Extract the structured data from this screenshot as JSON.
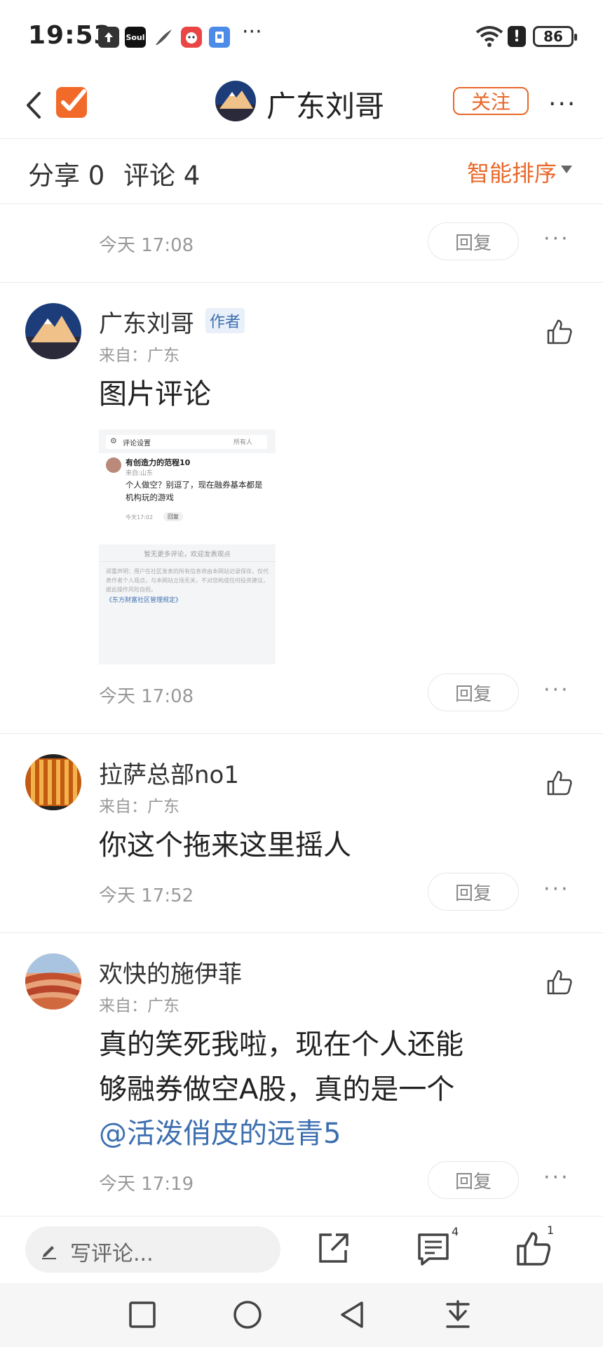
{
  "status_bar": {
    "time": "19:53",
    "app_icons": [
      "upload-icon",
      "soul-app-icon",
      "feather-app-icon",
      "mascot-app-icon",
      "badge-app-icon"
    ],
    "soul_text": "Soul",
    "overflow": "···",
    "battery": "86"
  },
  "header": {
    "title": "广东刘哥",
    "follow_label": "关注",
    "more": "···"
  },
  "tabs": {
    "share": "分享 0",
    "comments": "评论 4",
    "sort_label": "智能排序"
  },
  "comments": [
    {
      "time": "今天 17:08",
      "reply_label": "回复"
    },
    {
      "user": "广东刘哥",
      "author_tag": "作者",
      "from": "来自：广东",
      "text": "图片评论",
      "time": "今天 17:08",
      "reply_label": "回复",
      "image": {
        "header": "评论设置",
        "header_right": "所有人",
        "inner_user": "有创造力的范程10",
        "inner_from": "来自:山东",
        "inner_text": "个人做空？别逗了，现在融券基本都是机构玩的游戏",
        "inner_time": "今天17:02",
        "inner_reply": "回复",
        "empty_note": "暂无更多评论，欢迎发表观点",
        "disclaimer": "郑重声明：用户在社区发表的所有信息将由本网站记录保存，仅代表作者个人观点，与本网站立场无关，不对您构成任何投资建议，据此操作风险自担。",
        "rules_link": "《东方财富社区管理规定》"
      }
    },
    {
      "user": "拉萨总部no1",
      "from": "来自：广东",
      "text": "你这个拖来这里摇人",
      "time": "今天 17:52",
      "reply_label": "回复"
    },
    {
      "user": "欢快的施伊菲",
      "from": "来自：广东",
      "text_line1": "真的笑死我啦，现在个人还能",
      "text_line2": "够融券做空A股，真的是一个",
      "mention": "@活泼俏皮的远青5",
      "time": "今天 17:19",
      "reply_label": "回复"
    }
  ],
  "bottom_bar": {
    "write_placeholder": "写评论...",
    "comment_count": "4",
    "like_count": "1"
  },
  "colors": {
    "accent": "#e8682a",
    "link": "#3d6fb0"
  }
}
